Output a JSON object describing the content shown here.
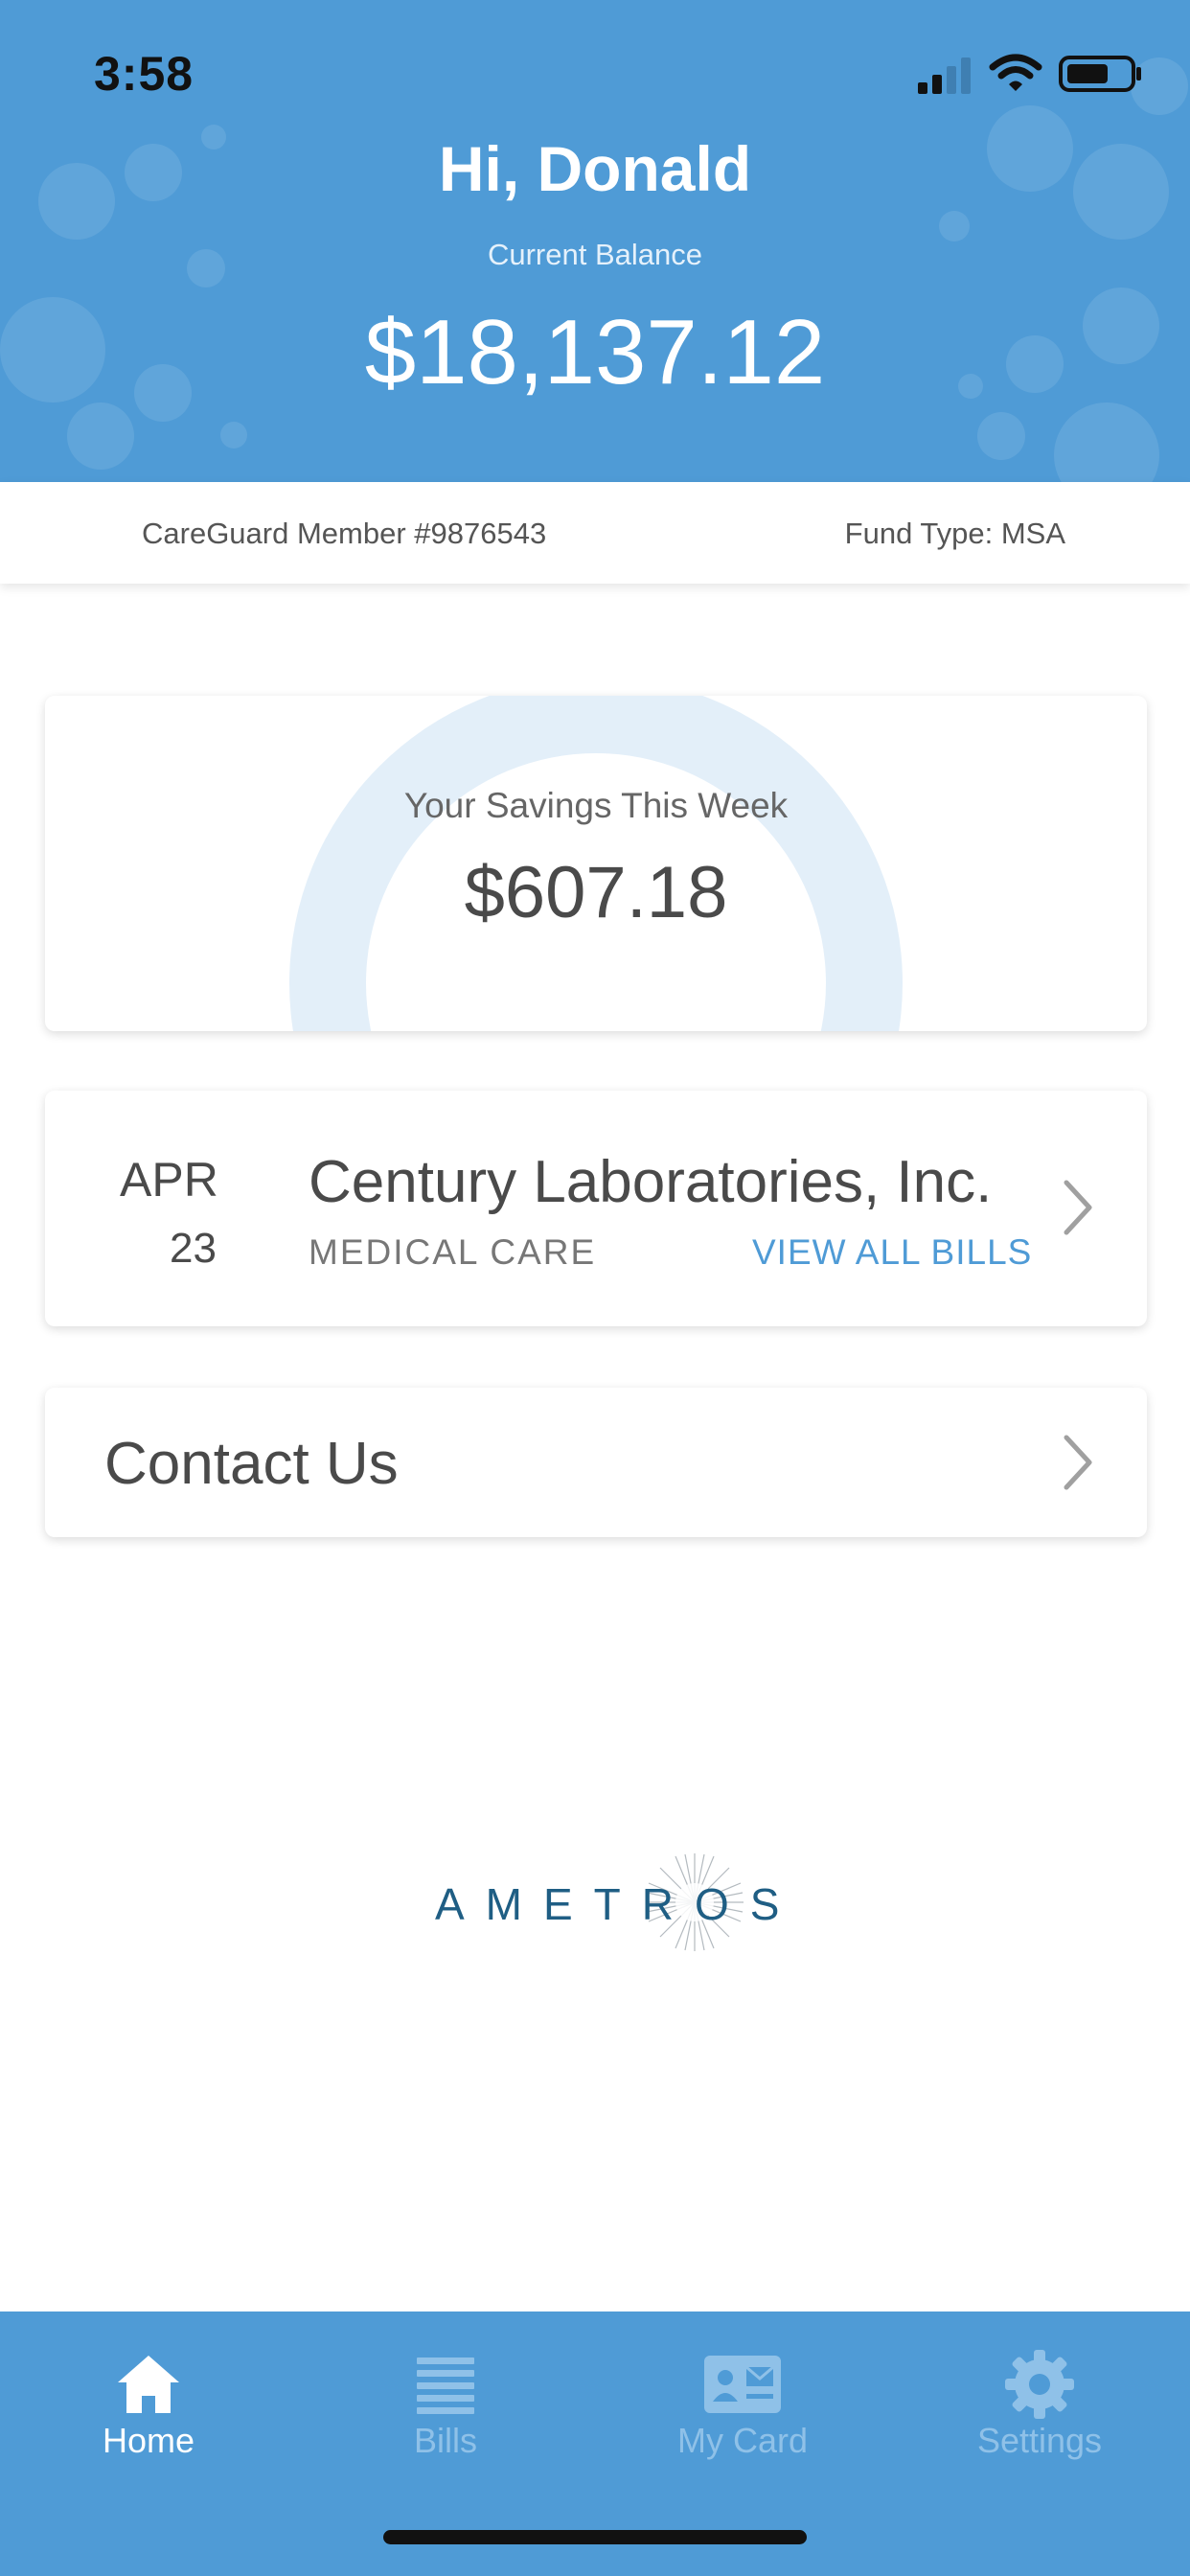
{
  "status_bar": {
    "time": "3:58"
  },
  "header": {
    "greeting": "Hi, Donald",
    "balance_label": "Current Balance",
    "balance_amount": "$18,137.12"
  },
  "member_bar": {
    "member_number": "CareGuard Member #9876543",
    "fund_type": "Fund Type: MSA"
  },
  "savings_card": {
    "label": "Your Savings This Week",
    "amount": "$607.18"
  },
  "bill_card": {
    "month": "APR",
    "day": "23",
    "provider": "Century Laboratories, Inc.",
    "category": "MEDICAL CARE",
    "view_all_label": "VIEW ALL BILLS"
  },
  "contact_card": {
    "label": "Contact Us"
  },
  "logo": {
    "text": "AMETROS"
  },
  "tab_bar": {
    "tabs": [
      {
        "label": "Home",
        "icon": "home-icon",
        "active": true
      },
      {
        "label": "Bills",
        "icon": "list-icon",
        "active": false
      },
      {
        "label": "My Card",
        "icon": "id-card-icon",
        "active": false
      },
      {
        "label": "Settings",
        "icon": "gear-icon",
        "active": false
      }
    ]
  },
  "colors": {
    "primary": "#4f9bd6",
    "text_dark": "#4a4a4a",
    "ring": "#e3eff9",
    "logo": "#1f5e84"
  }
}
